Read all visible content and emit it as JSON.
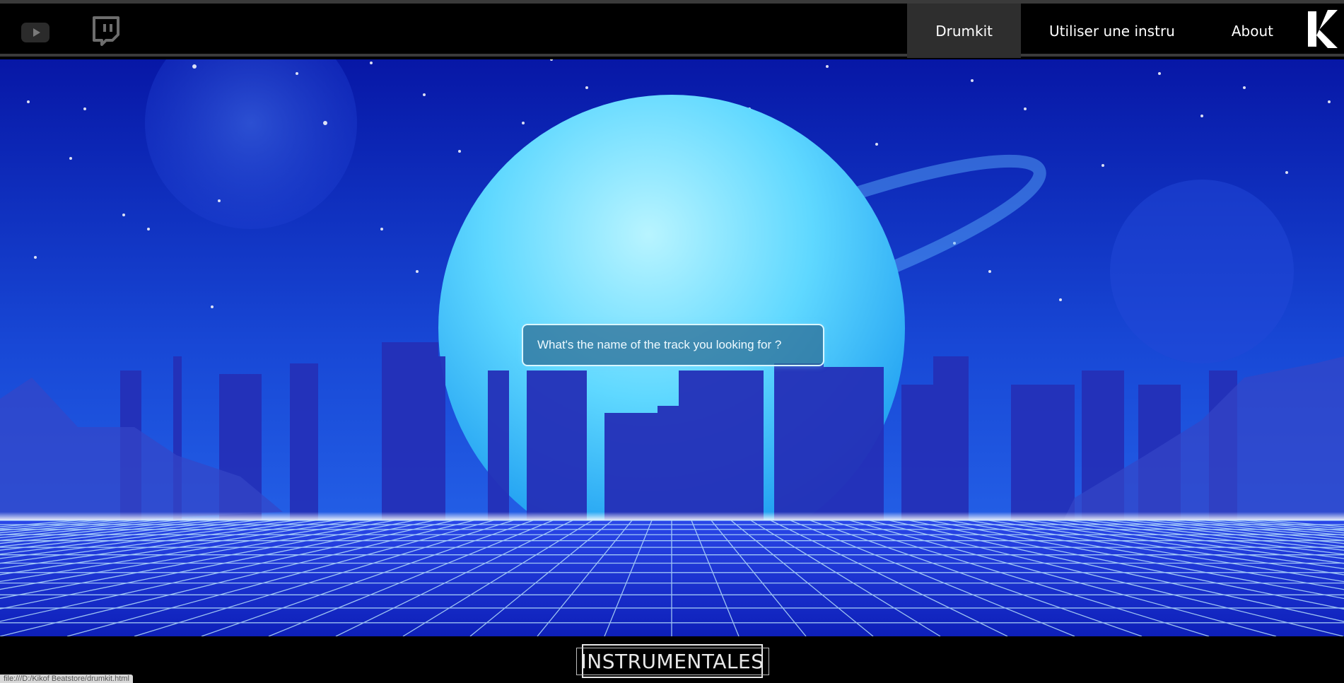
{
  "nav": {
    "social": [
      {
        "name": "youtube"
      },
      {
        "name": "twitch"
      }
    ],
    "items": [
      {
        "label": "Drumkit",
        "active": true
      },
      {
        "label": "Utiliser une instru",
        "active": false
      },
      {
        "label": "About",
        "active": false
      }
    ],
    "logo": "K"
  },
  "search": {
    "placeholder": "What's the name of the track you looking for ?",
    "value": ""
  },
  "footer": {
    "title": "INSTRUMENTALES"
  },
  "status_bar": {
    "url": "file:///D:/Kikof Beatstore/drumkit.html"
  },
  "colors": {
    "navbar_bg": "#000000",
    "active_tab": "#2e2e2e",
    "hero_deep": "#0a1aa0",
    "planet_cyan": "#5fe2ff"
  }
}
